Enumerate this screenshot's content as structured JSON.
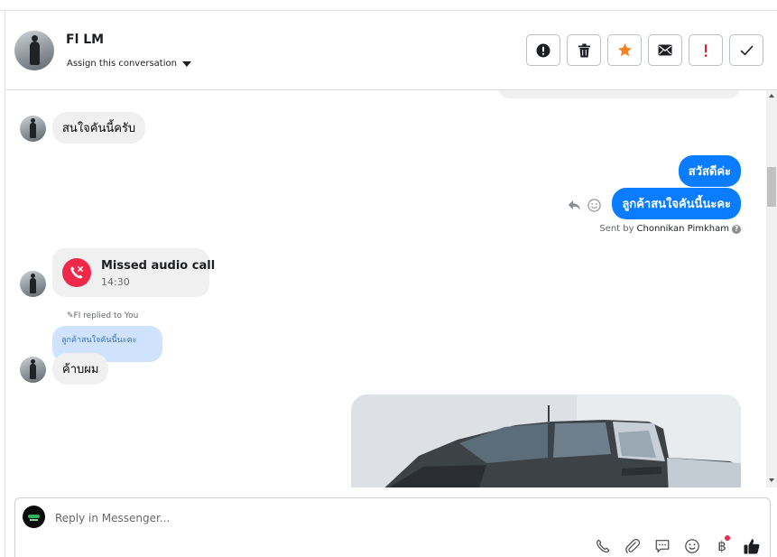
{
  "header": {
    "contact_name": "Fl LM",
    "assign_label": "Assign this conversation",
    "actions": [
      {
        "name": "spam-button",
        "icon": "alert-circle-icon"
      },
      {
        "name": "delete-button",
        "icon": "trash-icon"
      },
      {
        "name": "star-button",
        "icon": "star-icon"
      },
      {
        "name": "mark-unread-button",
        "icon": "envelope-icon"
      },
      {
        "name": "important-button",
        "icon": "exclamation-icon"
      },
      {
        "name": "done-button",
        "icon": "checkmark-icon"
      }
    ]
  },
  "messages": {
    "incoming_1": "สนใจคันนี้ครับ",
    "outgoing_1": "สวัสดีค่ะ",
    "outgoing_2": "ลูกค้าสนใจคันนี้นะคะ",
    "sent_by_prefix": "Sent by",
    "sent_by_name": "Chonnikan Pimkham",
    "missed_call_title": "Missed audio call",
    "missed_call_time": "14:30",
    "replied_label": "Fl replied to You",
    "quoted_text": "ลูกค้าสนใจคันนี้นะคะ",
    "incoming_2": "ค้าบผม"
  },
  "composer": {
    "placeholder": "Reply in Messenger...",
    "tools": [
      "phone-icon",
      "paperclip-icon",
      "chat-bubble-icon",
      "emoji-icon",
      "baht-icon",
      "thumbs-up-icon"
    ],
    "baht_symbol": "฿"
  },
  "colors": {
    "outgoing_bubble": "#0a7cff",
    "incoming_bubble": "#f0f0f0",
    "missed_call": "#f02849",
    "star": "#f5821f",
    "important": "#e41e3f"
  }
}
